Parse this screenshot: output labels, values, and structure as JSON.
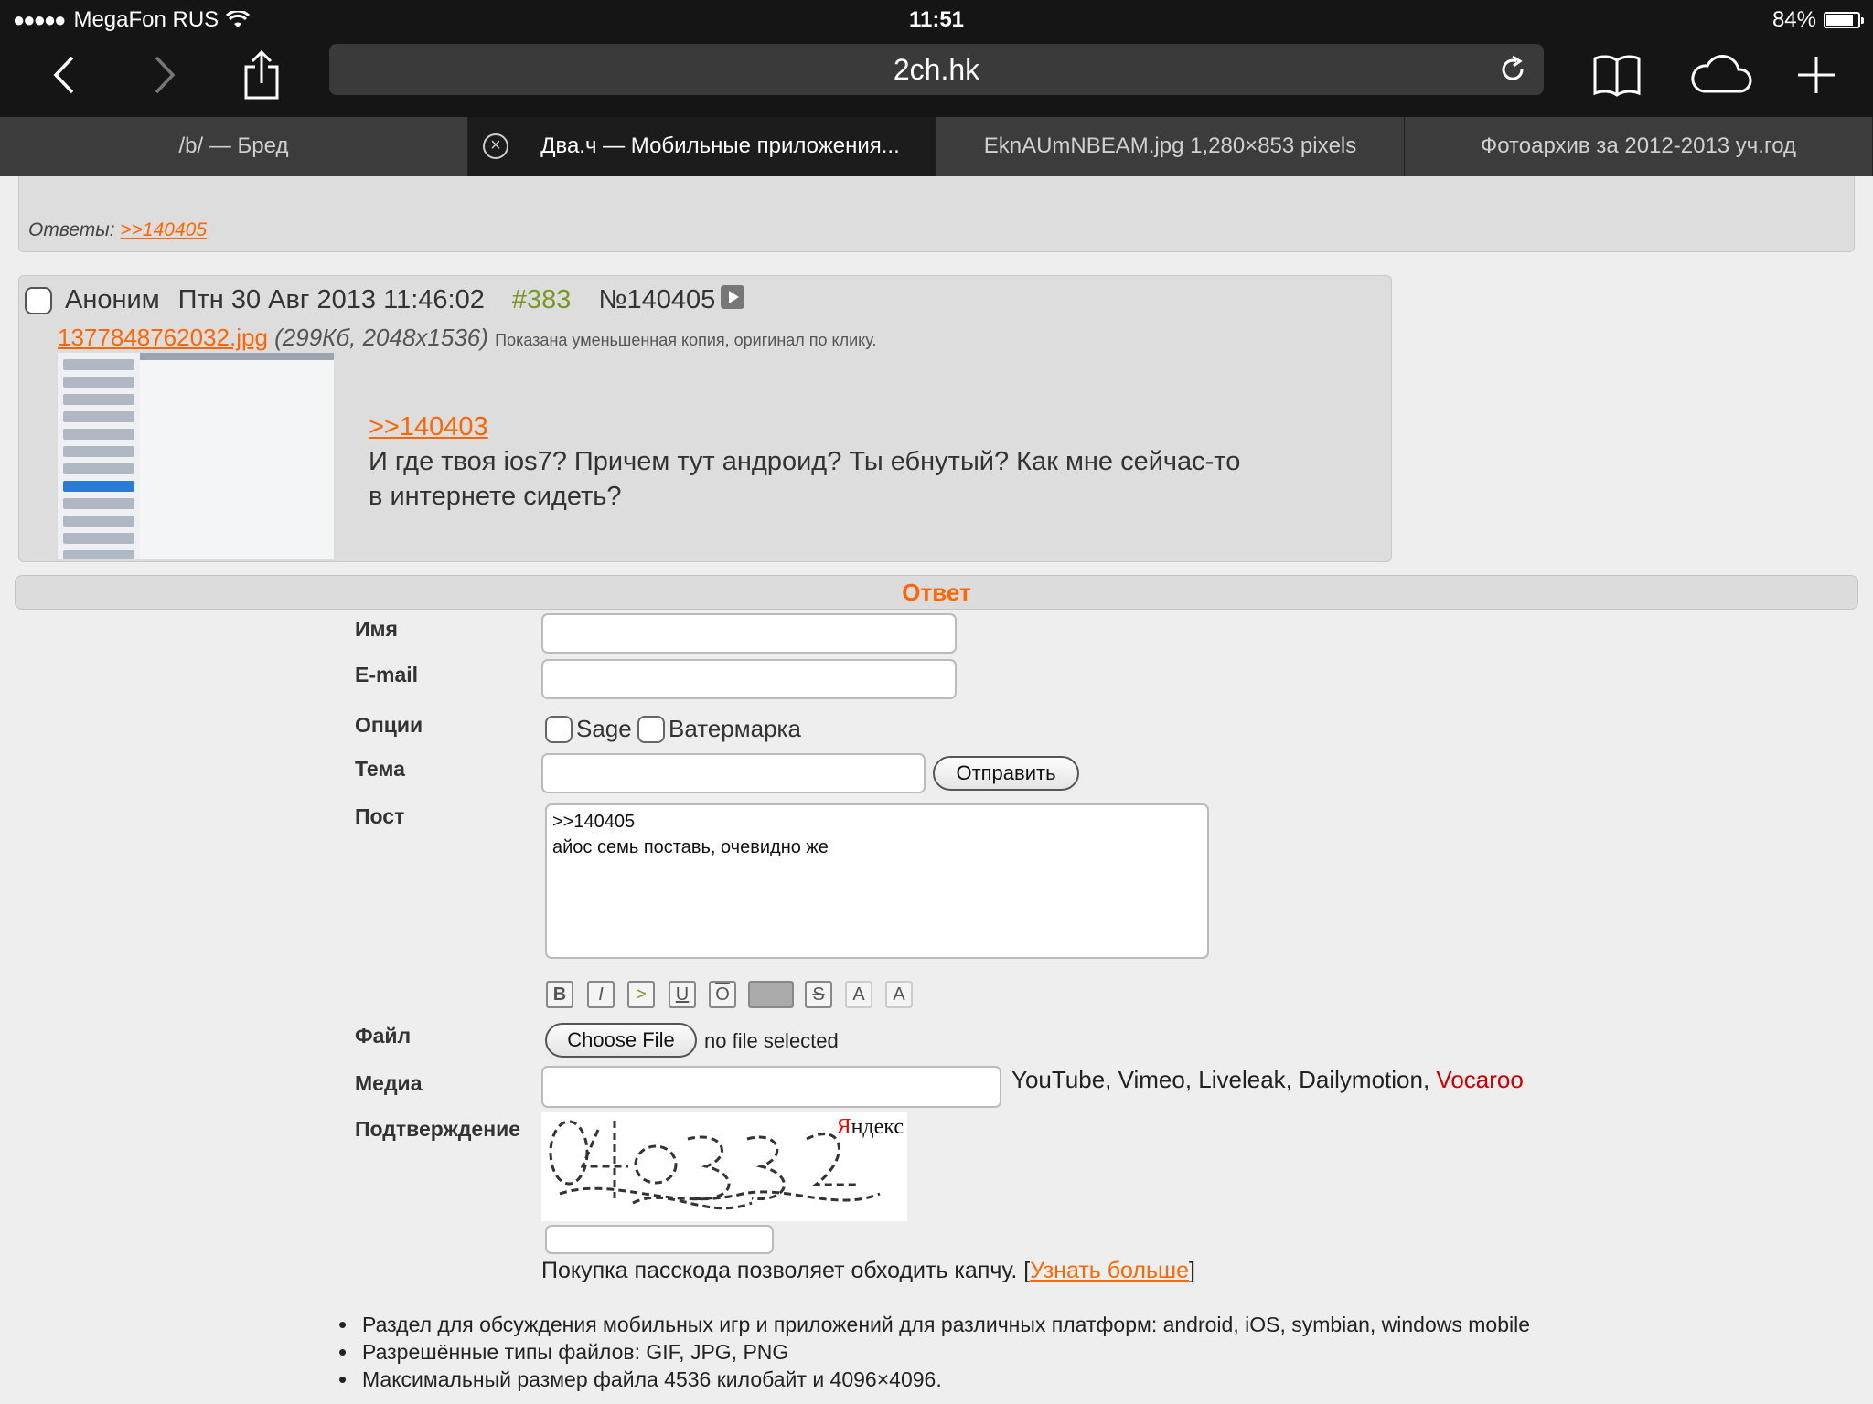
{
  "status": {
    "carrier": "MegaFon RUS",
    "time": "11:51",
    "battery": "84%",
    "battery_level": 0.84
  },
  "browser": {
    "url": "2ch.hk",
    "tabs": [
      {
        "title": "/b/ — Бред",
        "active": false
      },
      {
        "title": "Два.ч — Мобильные приложения...",
        "active": true
      },
      {
        "title": "EknAUmNBEAM.jpg 1,280×853 pixels",
        "active": false
      },
      {
        "title": "Фотоархив за 2012-2013 уч.год",
        "active": false
      }
    ],
    "icons": [
      "back-icon",
      "forward-icon",
      "share-icon",
      "reload-icon",
      "bookmarks-icon",
      "cloud-tabs-icon",
      "new-tab-icon"
    ]
  },
  "previous_post": {
    "replies_label": "Ответы:",
    "reply_link": ">>140405"
  },
  "post": {
    "author": "Аноним",
    "date": "Птн 30 Авг 2013 11:46:02",
    "index": "#383",
    "number": "№140405",
    "file_name": "1377848762032.jpg",
    "file_meta": "(299Кб, 2048x1536)",
    "thumb_note": "Показана уменьшенная копия, оригинал по клику.",
    "quote_link": ">>140403",
    "text_line1": "И где твоя ios7? Причем тут андроид? Ты ебнутый? Как мне сейчас-то",
    "text_line2": "в интернете сидеть?"
  },
  "reply_form": {
    "header": "Ответ",
    "name_label": "Имя",
    "email_label": "E-mail",
    "options_label": "Опции",
    "sage_label": "Sage",
    "watermark_label": "Ватермарка",
    "subject_label": "Тема",
    "submit_label": "Отправить",
    "post_label": "Пост",
    "post_text": ">>140405\nайос семь поставь, очевидно же",
    "format_buttons": [
      "B",
      "I",
      ">",
      "U",
      "O",
      "",
      "S",
      "A",
      "A"
    ],
    "file_label": "Файл",
    "choose_file_label": "Choose File",
    "no_file": "no file selected",
    "media_label": "Медиа",
    "media_hint": "YouTube, Vimeo, Liveleak, Dailymotion,",
    "media_vocaroo": "Vocaroo",
    "captcha_label": "Подтверждение",
    "captcha_brand_first": "Я",
    "captcha_brand_rest": "ндекс",
    "passcode_text": "Покупка пасскода позволяет обходить капчу. [",
    "passcode_link": "Узнать больше",
    "passcode_end": "]"
  },
  "rules": [
    "Раздел для обсуждения мобильных игр и приложений для различных платформ: android, iOS, symbian, windows mobile",
    "Разрешённые типы файлов: GIF, JPG, PNG",
    "Максимальный размер файла 4536 килобайт и 4096×4096."
  ],
  "colors": {
    "accent": "#ff6600",
    "post_number": "#779922",
    "vocaroo": "#cc0000"
  }
}
